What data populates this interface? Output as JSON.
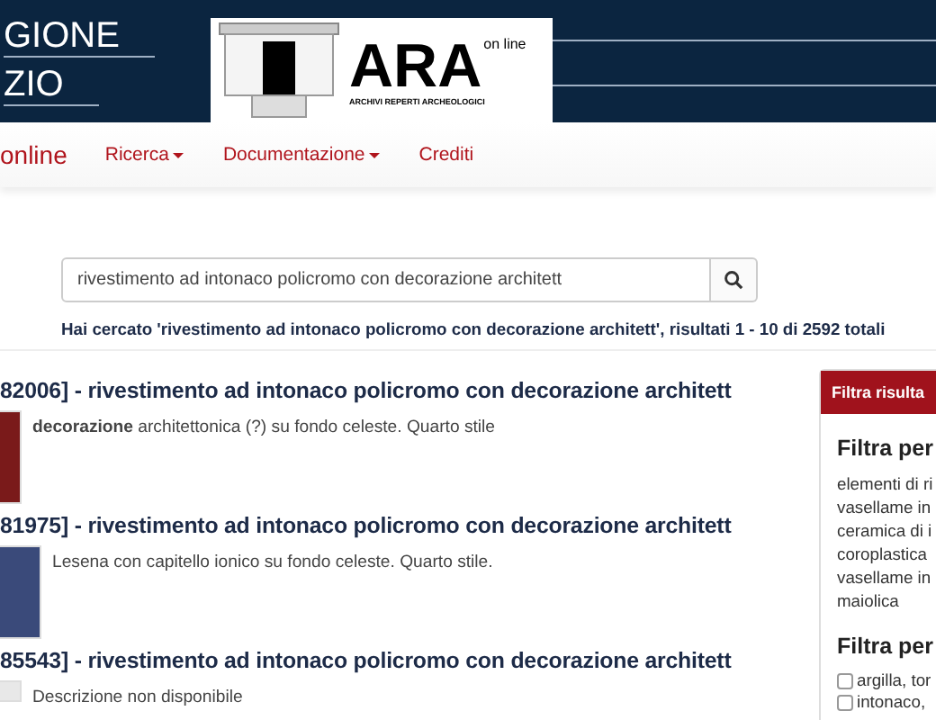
{
  "header": {
    "region_lines": [
      "GIONE",
      "ZIO"
    ],
    "logo": {
      "title": "ARA",
      "tag": "on line",
      "subtitle": "ARCHIVI REPERTI ARCHEOLOGICI"
    }
  },
  "nav": {
    "brand": "online",
    "items": [
      {
        "label": "Ricerca",
        "dropdown": true
      },
      {
        "label": "Documentazione",
        "dropdown": true
      },
      {
        "label": "Crediti",
        "dropdown": false
      }
    ]
  },
  "search": {
    "value": "rivestimento ad intonaco policromo con decorazione architett",
    "summary": "Hai cercato 'rivestimento ad intonaco policromo con decorazione architett', risultati 1 - 10 di 2592 totali"
  },
  "results": [
    {
      "title": "82006] - rivestimento ad intonaco policromo con decorazione architett",
      "description": "**decorazione** architettonica (?) su fondo celeste. Quarto stile"
    },
    {
      "title": "81975] - rivestimento ad intonaco policromo con decorazione architett",
      "description": "Lesena con capitello ionico su fondo celeste. Quarto stile."
    },
    {
      "title": "85543] - rivestimento ad intonaco policromo con decorazione architett",
      "description": "Descrizione non disponibile"
    }
  ],
  "filters": {
    "title": "Filtra risulta",
    "groups": [
      {
        "heading": "Filtra per",
        "kind": "links",
        "items": [
          {
            "label": "elementi di ri"
          },
          {
            "label": "vasellame in"
          },
          {
            "label": "ceramica di i"
          },
          {
            "label": "coroplastica"
          },
          {
            "label": "vasellame in"
          },
          {
            "label": "maiolica"
          }
        ]
      },
      {
        "heading": "Filtra per",
        "kind": "checks",
        "items": [
          {
            "label": "argilla, tor",
            "checked": false
          },
          {
            "label": "intonaco,",
            "checked": false
          }
        ]
      }
    ]
  }
}
